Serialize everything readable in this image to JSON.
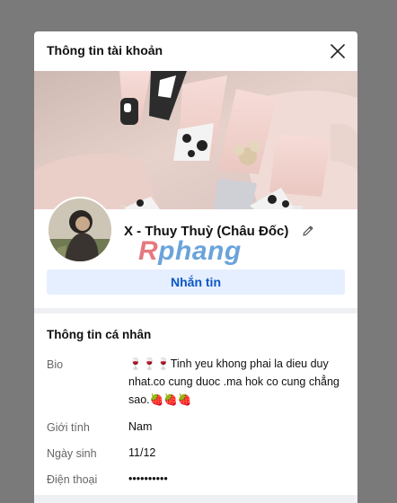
{
  "modal": {
    "title": "Thông tin tài khoản"
  },
  "profile": {
    "name": "X - Thuy Thuỳ (Châu Đốc)",
    "message_label": "Nhắn tin",
    "watermark_part1": "R",
    "watermark_part2": "phang"
  },
  "personal_info": {
    "title": "Thông tin cá nhân",
    "rows": [
      {
        "label": "Bio",
        "value": "🍷🍷🍷Tinh yeu khong phai la dieu duy nhat.co cung duoc .ma hok co cung chẳng sao.🍓🍓🍓"
      },
      {
        "label": "Giới tính",
        "value": "Nam"
      },
      {
        "label": "Ngày sinh",
        "value": "11/12"
      },
      {
        "label": "Điện thoại",
        "value": "••••••••••"
      }
    ]
  },
  "colors": {
    "overlay": "#7a7a7a",
    "accent": "#0b57c5",
    "button_bg": "#e5efff"
  }
}
